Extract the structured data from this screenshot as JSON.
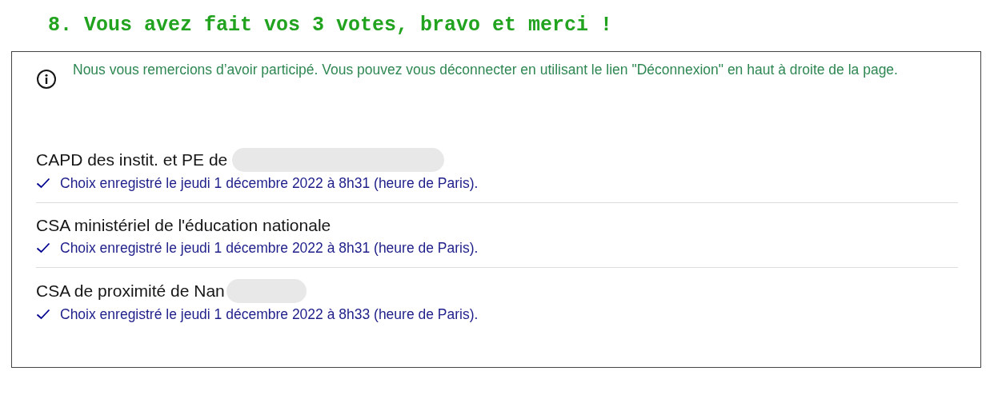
{
  "heading": "8. Vous avez fait vos 3 votes, bravo et merci !",
  "notice": "Nous vous remercions d’avoir participé. Vous pouvez vous déconnecter en utilisant le lien \"Déconnexion\" en haut à droite de la page.",
  "votes": [
    {
      "title": "CAPD des instit. et PE de",
      "redacted": true,
      "status": "Choix enregistré le jeudi 1 décembre 2022 à 8h31 (heure de Paris)."
    },
    {
      "title": "CSA ministériel de l'éducation nationale",
      "redacted": false,
      "status": "Choix enregistré le jeudi 1 décembre 2022 à 8h31 (heure de Paris)."
    },
    {
      "title": "CSA de proximité de Nan",
      "redacted": true,
      "status": "Choix enregistré le jeudi 1 décembre 2022 à 8h33 (heure de Paris)."
    }
  ]
}
